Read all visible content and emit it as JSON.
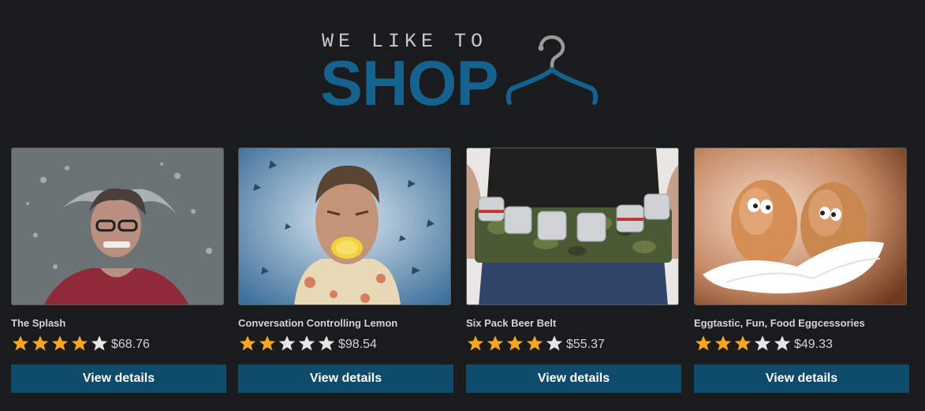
{
  "logo": {
    "tagline": "WE LIKE TO",
    "word": "SHOP",
    "icon": "hanger-icon",
    "colors": {
      "tagline": "#c9c9c9",
      "word": "#14628d"
    }
  },
  "products": [
    {
      "title": "The Splash",
      "rating": 4,
      "max_rating": 5,
      "price": "$68.76",
      "button_label": "View details"
    },
    {
      "title": "Conversation Controlling Lemon",
      "rating": 2,
      "max_rating": 5,
      "price": "$98.54",
      "button_label": "View details"
    },
    {
      "title": "Six Pack Beer Belt",
      "rating": 4,
      "max_rating": 5,
      "price": "$55.37",
      "button_label": "View details"
    },
    {
      "title": "Eggtastic, Fun, Food Eggcessories",
      "rating": 3,
      "max_rating": 5,
      "price": "$49.33",
      "button_label": "View details"
    }
  ],
  "colors": {
    "background": "#1a1b1d",
    "button": "#0e4a6a",
    "star_filled": "#f5a623",
    "star_empty": "#e6e6e6"
  }
}
